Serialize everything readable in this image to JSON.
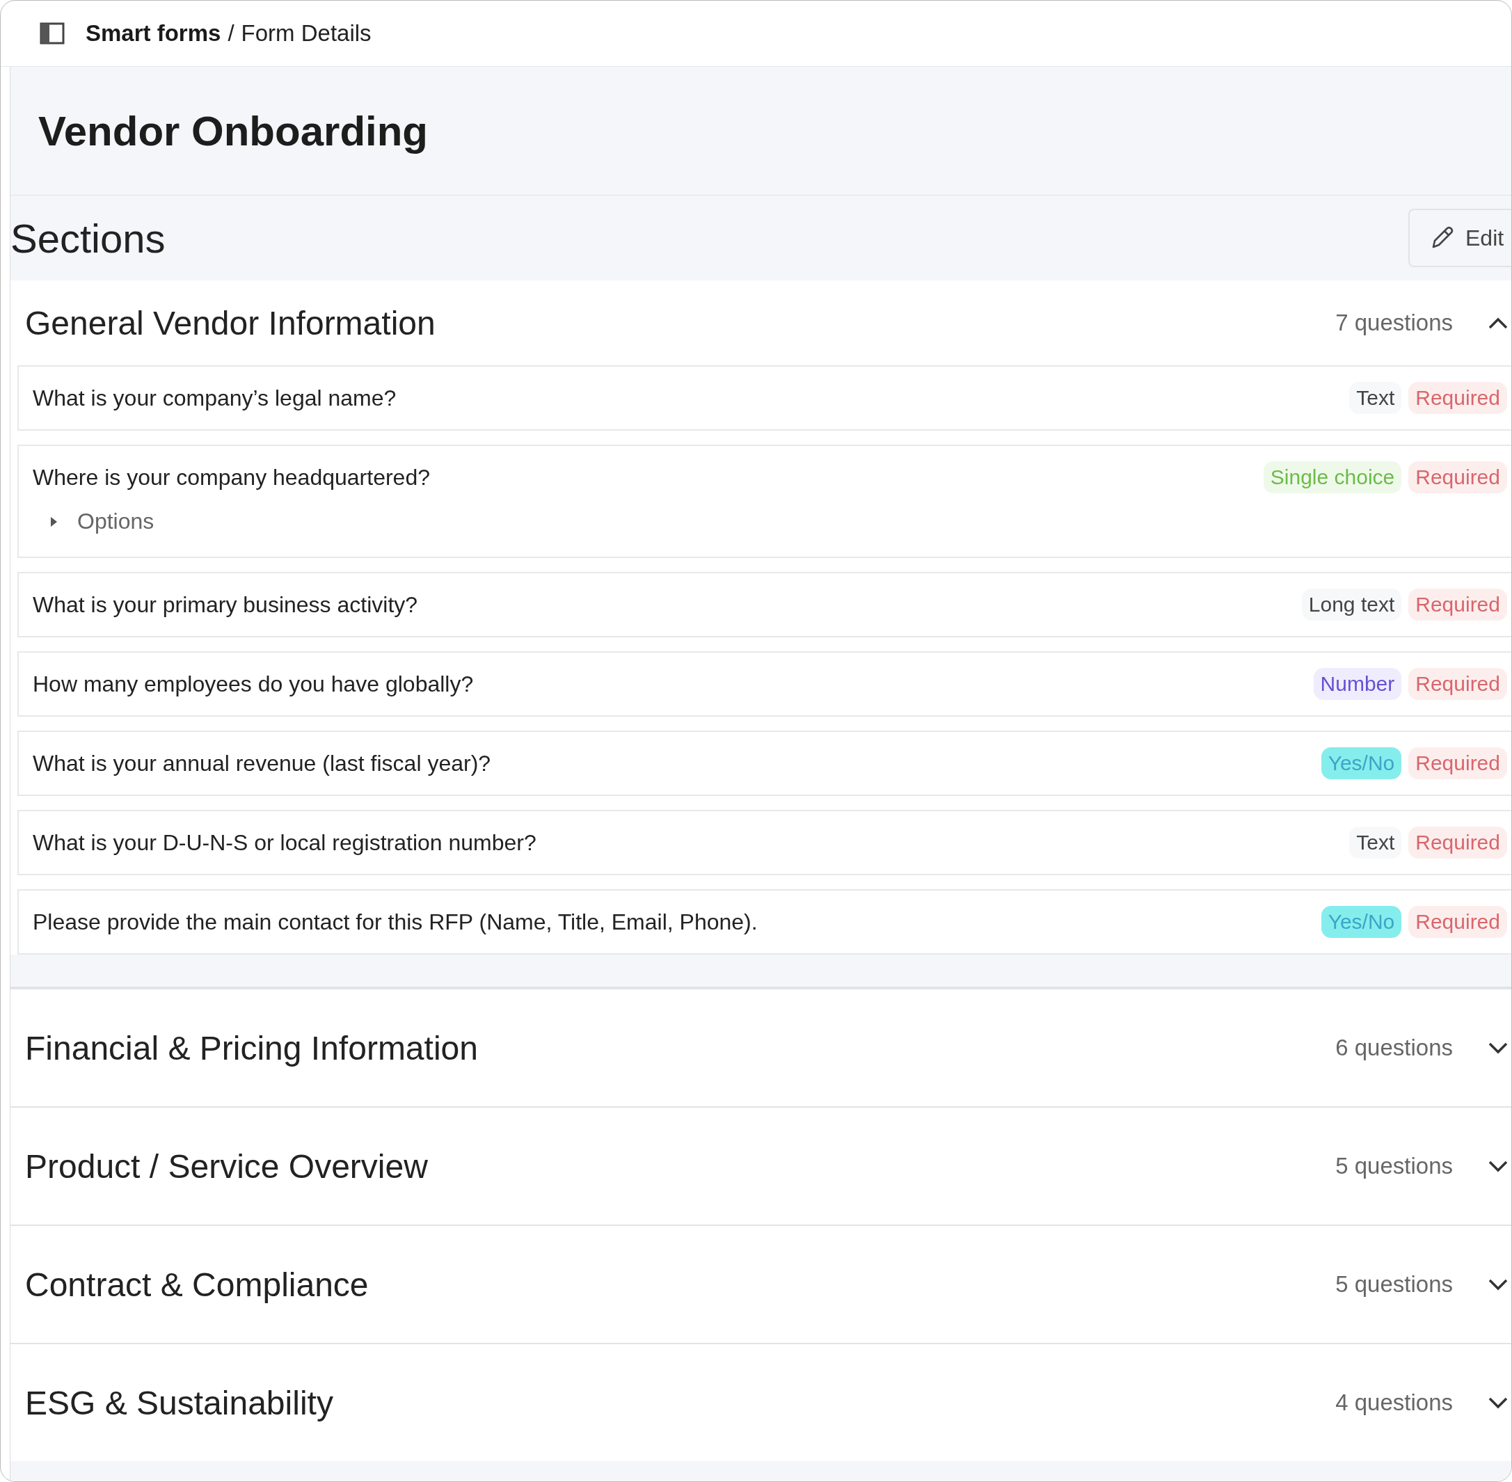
{
  "breadcrumb": {
    "parent": "Smart forms",
    "separator": "/",
    "current": "Form Details"
  },
  "title": "Vendor Onboarding",
  "sections_heading": "Sections",
  "edit_button": "Edit",
  "sections": [
    {
      "title": "General Vendor Information",
      "count": "7 questions",
      "expanded": true,
      "questions": [
        {
          "text": "What is your company’s legal name?",
          "type": {
            "label": "Text",
            "kind": "text"
          },
          "required": "Required"
        },
        {
          "text": "Where is your company headquartered?",
          "type": {
            "label": "Single choice",
            "kind": "choice"
          },
          "required": "Required",
          "options": {
            "label": "Options",
            "expanded": false
          }
        },
        {
          "text": "What is your primary business activity?",
          "type": {
            "label": "Long text",
            "kind": "text"
          },
          "required": "Required"
        },
        {
          "text": "How many employees do you have globally?",
          "type": {
            "label": "Number",
            "kind": "number"
          },
          "required": "Required"
        },
        {
          "text": "What is your annual revenue (last fiscal year)?",
          "type": {
            "label": "Yes/No",
            "kind": "yesno"
          },
          "required": "Required"
        },
        {
          "text": "What is your D-U-N-S or local registration number?",
          "type": {
            "label": "Text",
            "kind": "text"
          },
          "required": "Required"
        },
        {
          "text": "Please provide the main contact for this RFP (Name, Title, Email, Phone).",
          "type": {
            "label": "Yes/No",
            "kind": "yesno"
          },
          "required": "Required"
        }
      ]
    },
    {
      "title": "Financial & Pricing Information",
      "count": "6 questions",
      "expanded": false
    },
    {
      "title": "Product / Service Overview",
      "count": "5 questions",
      "expanded": false
    },
    {
      "title": "Contract & Compliance",
      "count": "5 questions",
      "expanded": false
    },
    {
      "title": "ESG & Sustainability",
      "count": "4 questions",
      "expanded": false
    }
  ]
}
